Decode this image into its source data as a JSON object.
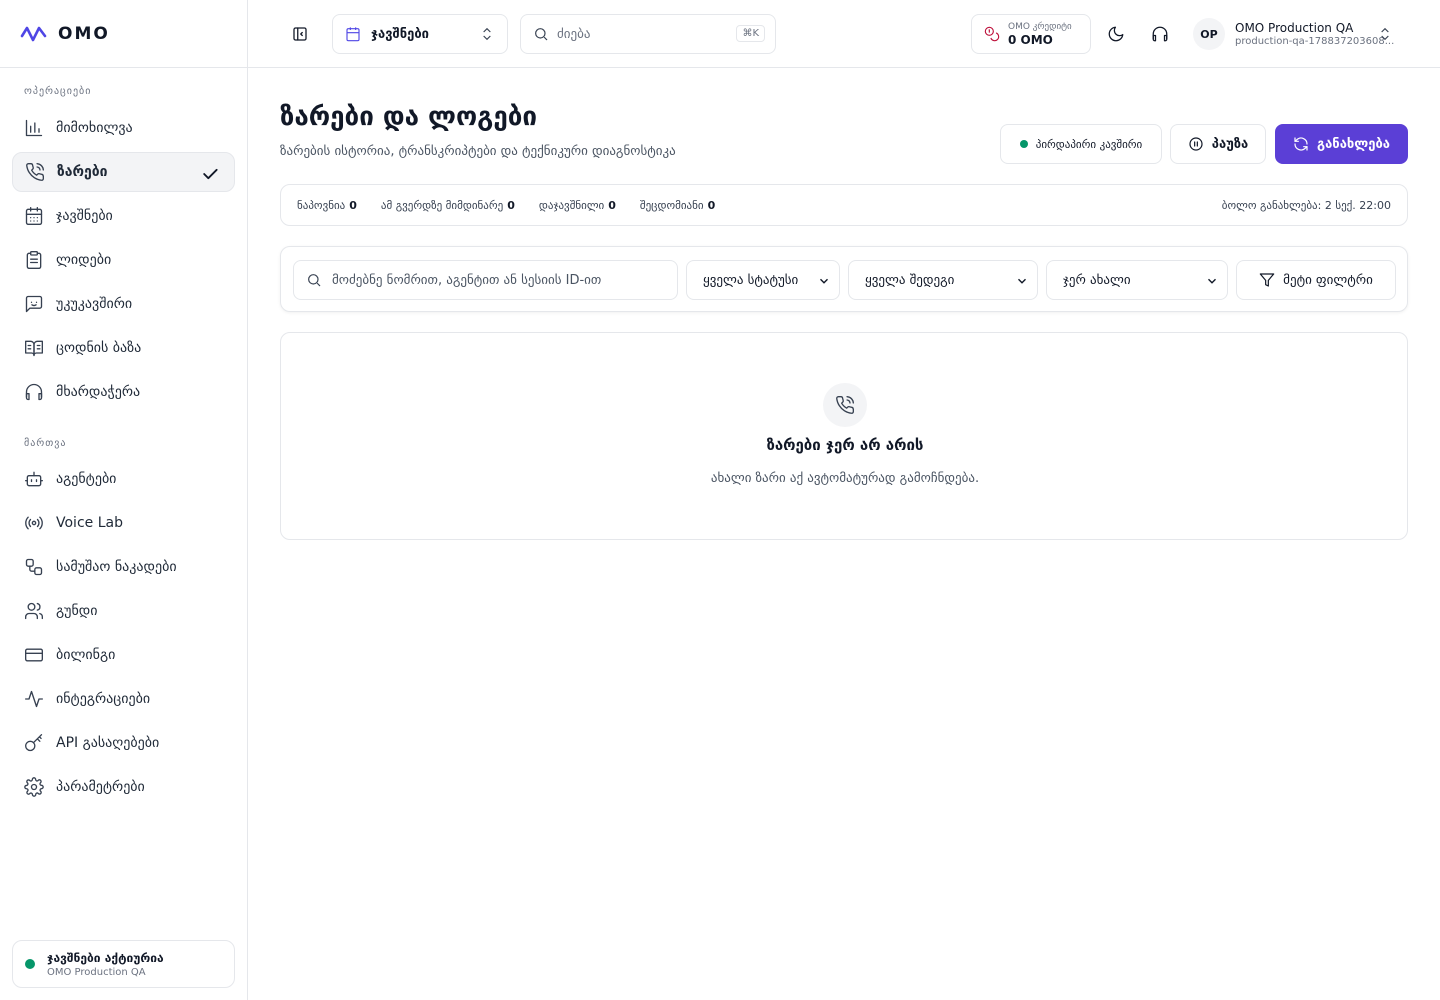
{
  "brand": {
    "name": "OMO",
    "accent": "#5b3fd6"
  },
  "sidebar": {
    "section_operations": "ოპერაციები",
    "section_management": "მართვა",
    "items": [
      {
        "label": "მიმოხილვა",
        "icon": "bar-chart-icon"
      },
      {
        "label": "ზარები",
        "icon": "phone-call-icon",
        "active": true
      },
      {
        "label": "ჯავშნები",
        "icon": "calendar-icon"
      },
      {
        "label": "ლიდები",
        "icon": "clipboard-icon"
      },
      {
        "label": "უკუკავშირი",
        "icon": "message-square-icon"
      },
      {
        "label": "ცოდნის ბაზა",
        "icon": "book-open-icon"
      },
      {
        "label": "მხარდაჭერა",
        "icon": "headphones-icon"
      },
      {
        "label": "აგენტები",
        "icon": "bot-icon"
      },
      {
        "label": "Voice Lab",
        "icon": "radio-icon"
      },
      {
        "label": "სამუშაო ნაკადები",
        "icon": "workflow-icon"
      },
      {
        "label": "გუნდი",
        "icon": "users-icon"
      },
      {
        "label": "ბილინგი",
        "icon": "credit-card-icon"
      },
      {
        "label": "ინტეგრაციები",
        "icon": "activity-icon"
      },
      {
        "label": "API გასაღებები",
        "icon": "key-icon"
      },
      {
        "label": "პარამეტრები",
        "icon": "settings-icon"
      }
    ],
    "status": {
      "title": "ჯავშნები აქტიურია",
      "subtitle": "OMO Production QA"
    }
  },
  "topbar": {
    "workspace": "ჯავშნები",
    "search_placeholder": "ძიება",
    "search_shortcut": "⌘K",
    "credits_label": "OMO კრედიტი",
    "credits_value": "0 OMO",
    "org_initials": "OP",
    "org_name": "OMO Production QA",
    "org_id": "production-qa-178837203608..."
  },
  "main": {
    "title": "ზარები და ლოგები",
    "subtitle": "ზარების ისტორია, ტრანსკრიპტები და ტექნიკური დიაგნოსტიკა",
    "live_label": "პირდაპირი კავშირი",
    "pause_label": "პაუზა",
    "refresh_label": "განახლება",
    "stats": [
      {
        "label": "ნაპოვნია",
        "value": "0"
      },
      {
        "label": "ამ გვერდზე მიმდინარე",
        "value": "0"
      },
      {
        "label": "დაჯავშნილი",
        "value": "0"
      },
      {
        "label": "შეცდომიანი",
        "value": "0"
      }
    ],
    "last_update": "ბოლო განახლება: 2 სექ. 22:00",
    "filters": {
      "search_placeholder": "მოძებნე ნომრით, აგენტით ან სესიის ID-ით",
      "status": "ყველა სტატუსი",
      "result": "ყველა შედეგი",
      "sort": "ჯერ ახალი",
      "more": "მეტი ფილტრი"
    },
    "empty": {
      "title": "ზარები ჯერ არ არის",
      "subtitle": "ახალი ზარი აქ ავტომატურად გამოჩნდება."
    }
  }
}
